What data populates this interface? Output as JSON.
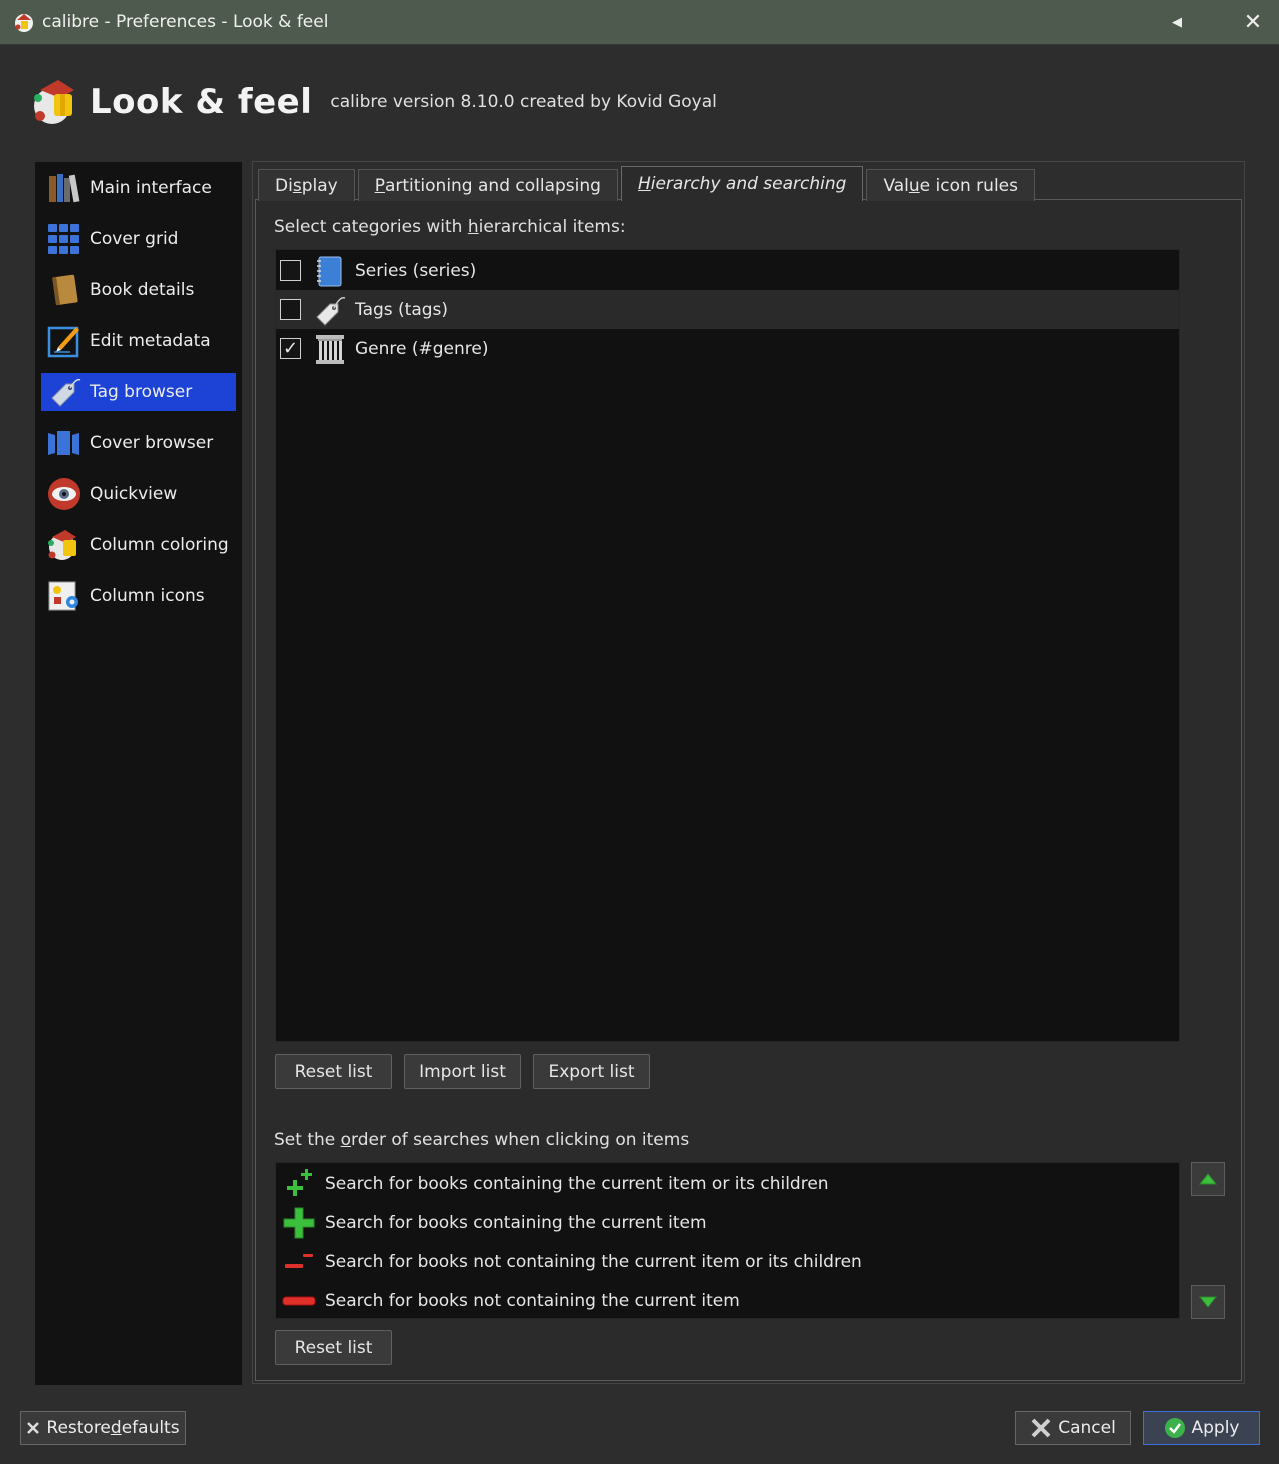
{
  "window": {
    "title": "calibre - Preferences - Look & feel"
  },
  "header": {
    "heading": "Look & feel",
    "version": "calibre version 8.10.0 created by Kovid Goyal"
  },
  "sidebar": {
    "items": [
      {
        "label": "Main interface",
        "icon": "books-icon"
      },
      {
        "label": "Cover grid",
        "icon": "grid-icon"
      },
      {
        "label": "Book details",
        "icon": "book-icon"
      },
      {
        "label": "Edit metadata",
        "icon": "edit-icon"
      },
      {
        "label": "Tag browser",
        "icon": "tag-icon",
        "active": true
      },
      {
        "label": "Cover browser",
        "icon": "covers-icon"
      },
      {
        "label": "Quickview",
        "icon": "eye-icon"
      },
      {
        "label": "Column coloring",
        "icon": "paint-icon"
      },
      {
        "label": "Column icons",
        "icon": "icons-icon"
      }
    ]
  },
  "tabs": [
    {
      "label_pre": "Di",
      "label_u": "s",
      "label_post": "play"
    },
    {
      "label_pre": "",
      "label_u": "P",
      "label_post": "artitioning and collapsing"
    },
    {
      "label_pre": "",
      "label_u": "H",
      "label_post": "ierarchy and searching",
      "active": true
    },
    {
      "label_pre": "Val",
      "label_u": "u",
      "label_post": "e icon rules"
    }
  ],
  "hierarchy": {
    "label_pre": "Select categories with ",
    "label_u": "h",
    "label_post": "ierarchical items:",
    "categories": [
      {
        "label": "Series (series)",
        "checked": false,
        "check_mark": "",
        "icon": "series-icon"
      },
      {
        "label": "Tags (tags)",
        "checked": false,
        "check_mark": "",
        "icon": "tags-icon"
      },
      {
        "label": "Genre (#genre)",
        "checked": true,
        "check_mark": "✓",
        "icon": "column-icon"
      }
    ],
    "buttons": {
      "reset": "Reset list",
      "import": "Import list",
      "export": "Export list"
    }
  },
  "search_order": {
    "label_pre": "Set the ",
    "label_u": "o",
    "label_post": "rder of searches when clicking on items",
    "items": [
      {
        "label": "Search for books containing the current item or its children",
        "icon": "plus-plus-icon"
      },
      {
        "label": "Search for books containing the current item",
        "icon": "plus-icon"
      },
      {
        "label": "Search for books not containing the current item or its children",
        "icon": "minus-minus-icon"
      },
      {
        "label": "Search for books not containing the current item",
        "icon": "minus-icon"
      }
    ],
    "reset": "Reset list"
  },
  "footer": {
    "restore_pre": "Restore ",
    "restore_u": "d",
    "restore_post": "efaults",
    "cancel": "Cancel",
    "apply": "Apply"
  },
  "colors": {
    "accent": "#1c43d6",
    "titlebar": "#4d5a4d",
    "list_bg": "#111111"
  }
}
